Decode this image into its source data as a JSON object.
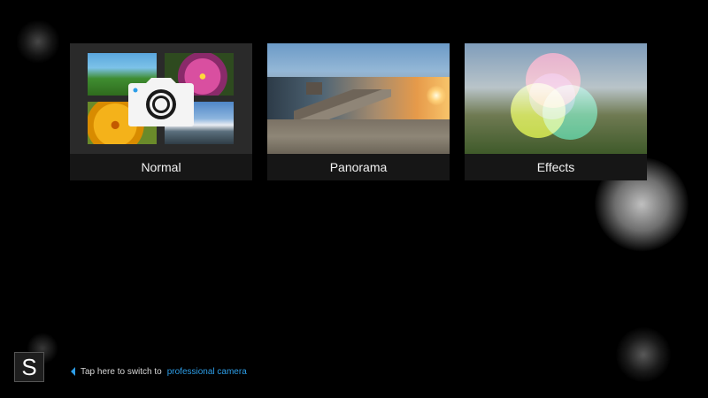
{
  "modes": [
    {
      "label": "Normal"
    },
    {
      "label": "Panorama"
    },
    {
      "label": "Effects"
    }
  ],
  "badge": {
    "letter": "S"
  },
  "hint": {
    "text": "Tap here to switch to",
    "link": "professional camera"
  },
  "colors": {
    "background": "#000000",
    "link": "#2d9ee8"
  }
}
